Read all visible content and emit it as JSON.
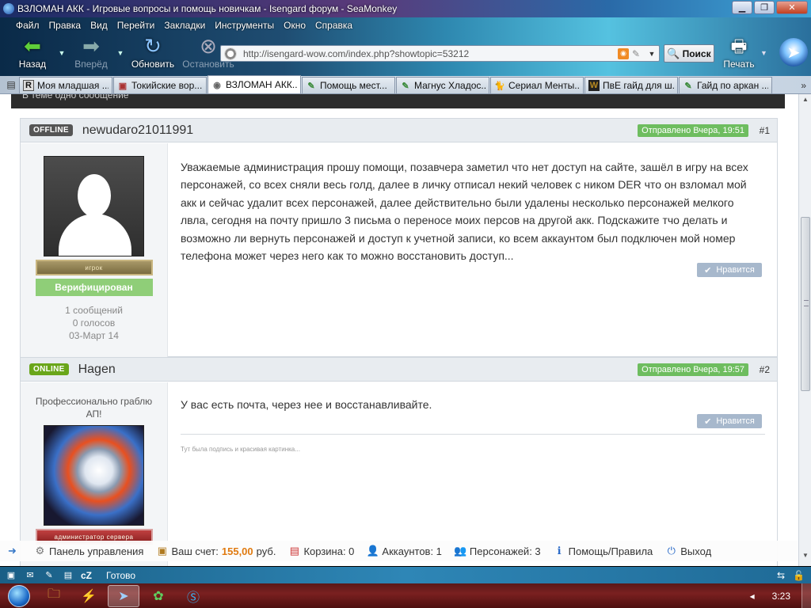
{
  "window": {
    "title": "ВЗЛОМАН АКК - Игровые вопросы и помощь новичкам - Isengard форум - SeaMonkey"
  },
  "menu": [
    "Файл",
    "Правка",
    "Вид",
    "Перейти",
    "Закладки",
    "Инструменты",
    "Окно",
    "Справка"
  ],
  "toolbar": {
    "back": "Назад",
    "forward": "Вперёд",
    "reload": "Обновить",
    "stop": "Остановить",
    "url": "http://isengard-wow.com/index.php?showtopic=53212",
    "search": "Поиск",
    "print": "Печать"
  },
  "tabs": [
    {
      "label": "Моя младшая ...",
      "icon": "R"
    },
    {
      "label": "Токийские вор...",
      "icon": "▣"
    },
    {
      "label": "ВЗЛОМАН АКК...",
      "icon": "◉",
      "active": true
    },
    {
      "label": "Помощь мест...",
      "icon": "✎"
    },
    {
      "label": "Магнус Хладос...",
      "icon": "✎"
    },
    {
      "label": "Сериал Менты...",
      "icon": "🐈"
    },
    {
      "label": "ПвЕ гайд для ш...",
      "icon": "W"
    },
    {
      "label": "Гайд по аркан ...",
      "icon": "✎"
    }
  ],
  "topic": {
    "header": "В теме одно сообщение"
  },
  "posts": [
    {
      "status": "OFFLINE",
      "author": "newudaro21011991",
      "sent": "Отправлено Вчера, 19:51",
      "num": "#1",
      "rank": "игрок",
      "badge": "Верифицирован",
      "stats": [
        "1 сообщений",
        "0 голосов",
        "03-Март 14"
      ],
      "body": "Уважаемые администрация прошу помощи, позавчера заметил что нет доступ на сайте, зашёл в игру на всех персонажей, со всех сняли весь голд, далее в личку отписал некий человек с ником DER что он взломал мой акк и сейчас удалит всех персонажей, далее действительно были удалены несколько персонажей мелкого лвла, сегодня на почту пришло 3 письма о переносе моих персов на другой акк. Подскажите тчо делать и возможно ли вернуть персонажей и доступ к учетной записи, ко всем аккаунтом был подключен мой номер телефона может через него как то можно восстановить доступ...",
      "like": "Нравится"
    },
    {
      "status": "ONLINE",
      "author": "Hagen",
      "sent": "Отправлено Вчера, 19:57",
      "num": "#2",
      "title": "Профессионально граблю АП!",
      "rank": "администратор сервера",
      "body": "У вас есть почта, через нее и восстанавливайте.",
      "like": "Нравится",
      "signature": "Тут была подпись и красивая картинка..."
    }
  ],
  "bottombar": {
    "panel": "Панель управления",
    "balance_label": "Ваш счет:",
    "balance_value": "155,00",
    "balance_unit": "руб.",
    "cart": "Корзина: 0",
    "accounts": "Аккаунтов: 1",
    "characters": "Персонажей: 3",
    "help": "Помощь/Правила",
    "logout": "Выход"
  },
  "statusbar": {
    "cz": "cZ",
    "text": "Готово"
  },
  "taskbar": {
    "clock": "3:23"
  }
}
